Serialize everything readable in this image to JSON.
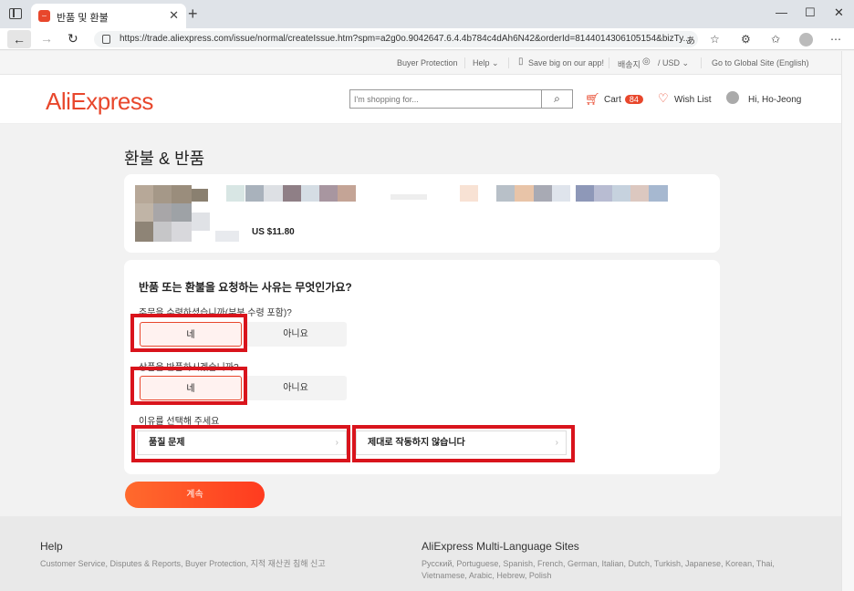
{
  "browser": {
    "tab_title": "반품 및 환불",
    "url": "https://trade.aliexpress.com/issue/normal/createIssue.htm?spm=a2g0o.9042647.6.4.4b784c4dAh6N42&orderId=8144014306105154&bizTy..."
  },
  "topnav": {
    "buyer_protection": "Buyer Protection",
    "help": "Help ⌄",
    "app": "Save big on our app!",
    "ship_to": "배송지",
    "currency": "/  USD ⌄",
    "global_site": "Go to Global Site (English)"
  },
  "header": {
    "logo": "AliExpress",
    "search_placeholder": "I'm shopping for...",
    "cart_label": "Cart",
    "cart_count": "84",
    "wishlist": "Wish List",
    "user": "Hi, Ho-Jeong"
  },
  "page_title": "환불 & 반품",
  "product": {
    "price": "US $11.80"
  },
  "form": {
    "question": "반품 또는 환불을 요청하는 사유는 무엇인가요?",
    "received_label": "주문을 수령하셨습니까(부분 수령 포함)?",
    "return_label": "상품을 반품하시겠습니까?",
    "yes": "네",
    "no": "아니요",
    "reason_label": "이유를 선택해 주세요",
    "reason_1": "품질 문제",
    "reason_2": "제대로 작동하지 않습니다",
    "continue": "계속"
  },
  "footer": {
    "help_title": "Help",
    "help_links": "Customer Service, Disputes & Reports, Buyer Protection, 지적 재산권 침해 신고",
    "lang_title": "AliExpress Multi-Language Sites",
    "lang_links_1": "Русский, Portuguese, Spanish, French, German, Italian, Dutch, Turkish, Japanese, Korean, Thai,",
    "lang_links_2": "Vietnamese, Arabic, Hebrew, Polish"
  },
  "colors": {
    "accent": "#e8472c",
    "highlight": "#d9141c"
  }
}
